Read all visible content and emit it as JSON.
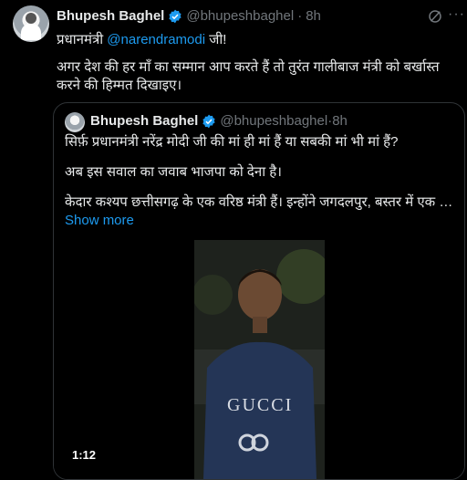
{
  "tweet": {
    "author_name": "Bhupesh Baghel",
    "handle": "@bhupeshbaghel",
    "time": "8h",
    "line1_prefix": "प्रधानमंत्री",
    "mention": "@narendramodi",
    "line1_suffix": "जी!",
    "body": "अगर देश की हर माँ का सम्मान आप करते हैं तो तुरंत गालीबाज मंत्री को बर्खास्त करने की हिम्मत दिखाइए।"
  },
  "quote": {
    "author_name": "Bhupesh Baghel",
    "handle": "@bhupeshbaghel",
    "time": "8h",
    "text1": "सिर्फ़ प्रधानमंत्री नरेंद्र मोदी जी की मां ही मां हैं या सबकी मां भी मां हैं?",
    "text2": "अब इस सवाल का जवाब भाजपा को देना है।",
    "text3": "केदार कश्यप छत्तीसगढ़ के एक वरिष्ठ मंत्री हैं। इन्होंने जगदलपुर, बस्तर में एक कर्मचा...",
    "show_more": "Show more",
    "video_time": "1:12",
    "shirt_text": "GUCCI"
  },
  "colors": {
    "accent": "#1d9bf0",
    "muted": "#71767b",
    "text": "#e7e9ea",
    "border": "#2f3336"
  }
}
